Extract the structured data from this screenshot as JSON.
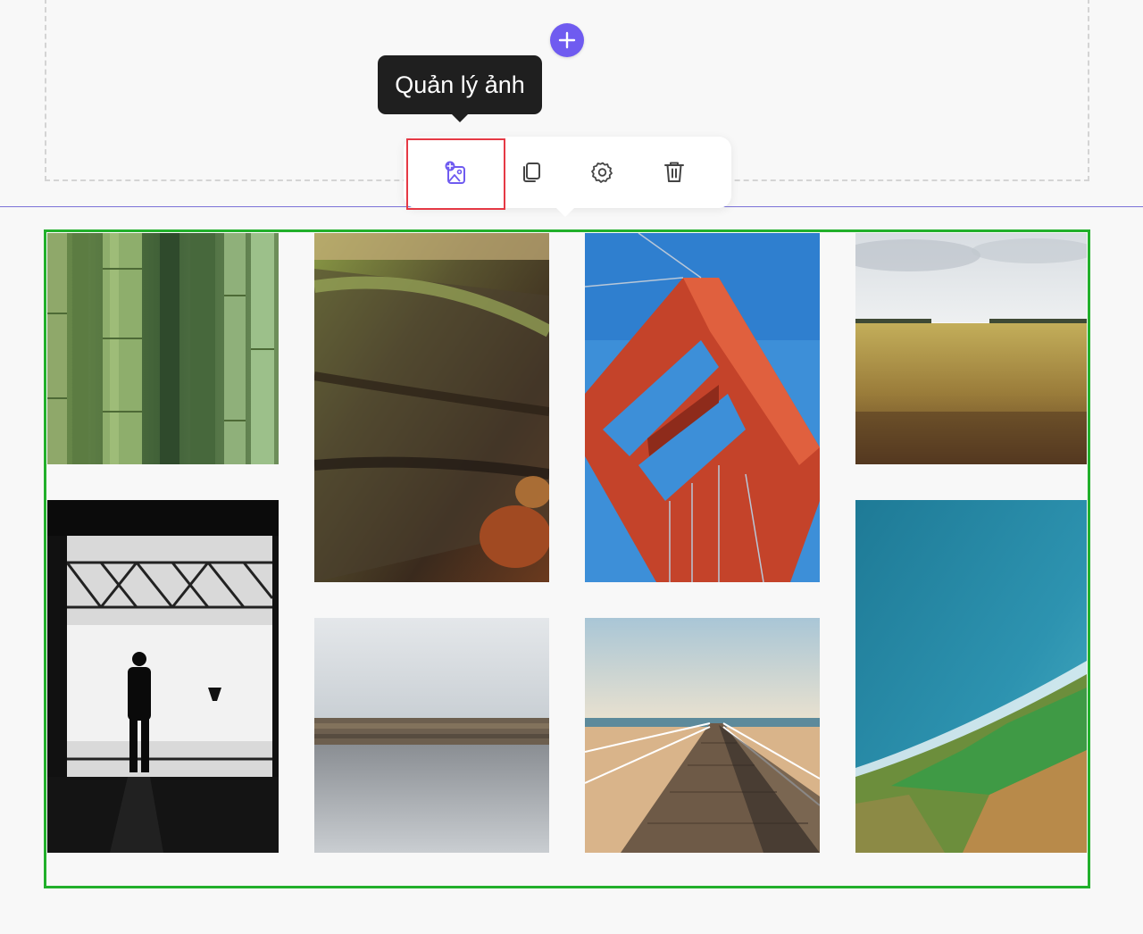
{
  "tooltip": {
    "text": "Quản lý ảnh"
  },
  "toolbar": {
    "buttons": [
      {
        "name": "manage-images",
        "icon": "image-plus-icon",
        "highlighted": true
      },
      {
        "name": "duplicate",
        "icon": "copy-icon",
        "highlighted": false
      },
      {
        "name": "settings",
        "icon": "gear-icon",
        "highlighted": false
      },
      {
        "name": "delete",
        "icon": "trash-icon",
        "highlighted": false
      }
    ]
  },
  "colors": {
    "accent": "#6f5bf0",
    "highlight_border": "#e53945",
    "selection_border": "#22b02b",
    "divider": "#7b73d8"
  },
  "gallery": {
    "photos": [
      {
        "subject": "bamboo"
      },
      {
        "subject": "mossy-log"
      },
      {
        "subject": "red-bridge-tower"
      },
      {
        "subject": "wheat-field"
      },
      {
        "subject": "silhouette-hangar"
      },
      {
        "subject": "rocky-breakwater"
      },
      {
        "subject": "wooden-pier"
      },
      {
        "subject": "aerial-coast"
      }
    ]
  }
}
